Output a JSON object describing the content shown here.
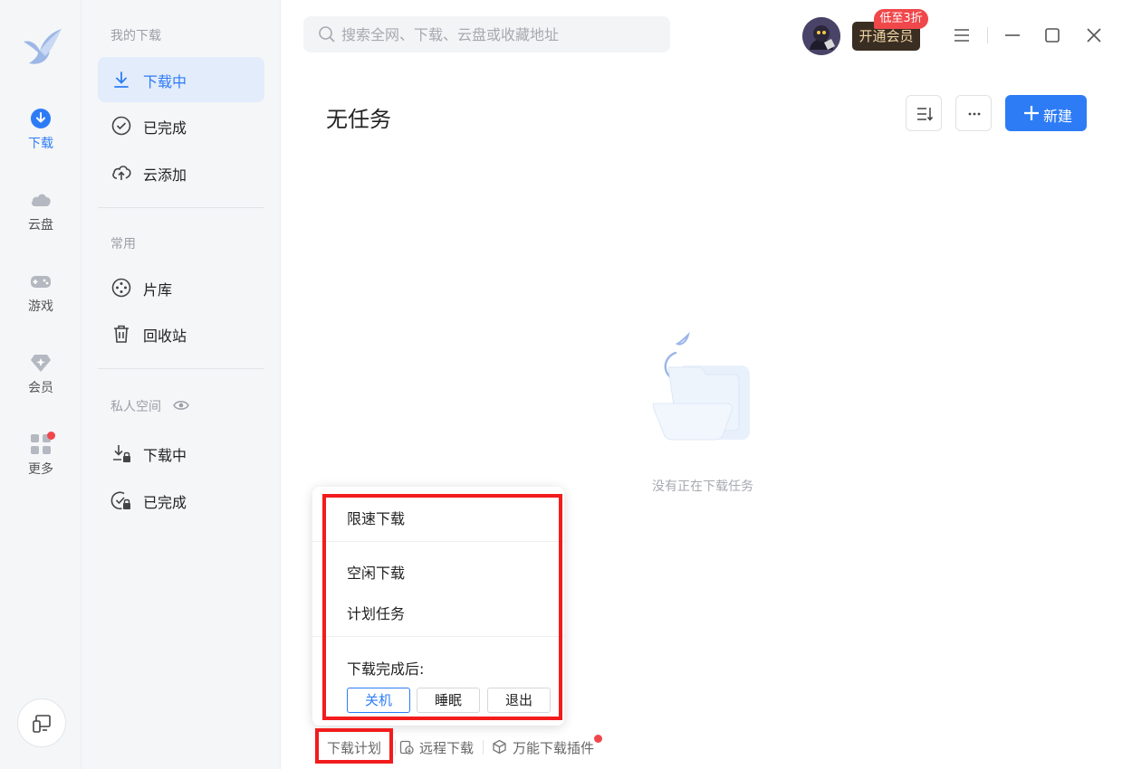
{
  "rail": {
    "items": [
      {
        "label": "下载",
        "icon": "download-circle-icon"
      },
      {
        "label": "云盘",
        "icon": "cloud-icon"
      },
      {
        "label": "游戏",
        "icon": "gamepad-icon"
      },
      {
        "label": "会员",
        "icon": "diamond-icon"
      },
      {
        "label": "更多",
        "icon": "apps-grid-icon"
      }
    ]
  },
  "sidebar": {
    "section_downloads": "我的下载",
    "section_common": "常用",
    "section_private": "私人空间",
    "items": [
      {
        "label": "下载中"
      },
      {
        "label": "已完成"
      },
      {
        "label": "云添加"
      },
      {
        "label": "片库"
      },
      {
        "label": "回收站"
      },
      {
        "label": "下载中"
      },
      {
        "label": "已完成"
      }
    ]
  },
  "header": {
    "search_placeholder": "搜索全网、下载、云盘或收藏地址",
    "vip_label": "开通会员",
    "vip_badge": "低至3折"
  },
  "main": {
    "title": "无任务",
    "new_label": "新建",
    "empty_text": "没有正在下载任务"
  },
  "menu": {
    "limit_speed": "限速下载",
    "idle_download": "空闲下载",
    "scheduled_task": "计划任务",
    "after_complete": "下载完成后:",
    "options": [
      "关机",
      "睡眠",
      "退出"
    ],
    "selected": "关机"
  },
  "bottom": {
    "plan": "下载计划",
    "remote": "远程下载",
    "plugin": "万能下载插件"
  },
  "colors": {
    "accent": "#2d7cf6",
    "highlight": "#f21c1c",
    "badge": "#f0474a"
  }
}
